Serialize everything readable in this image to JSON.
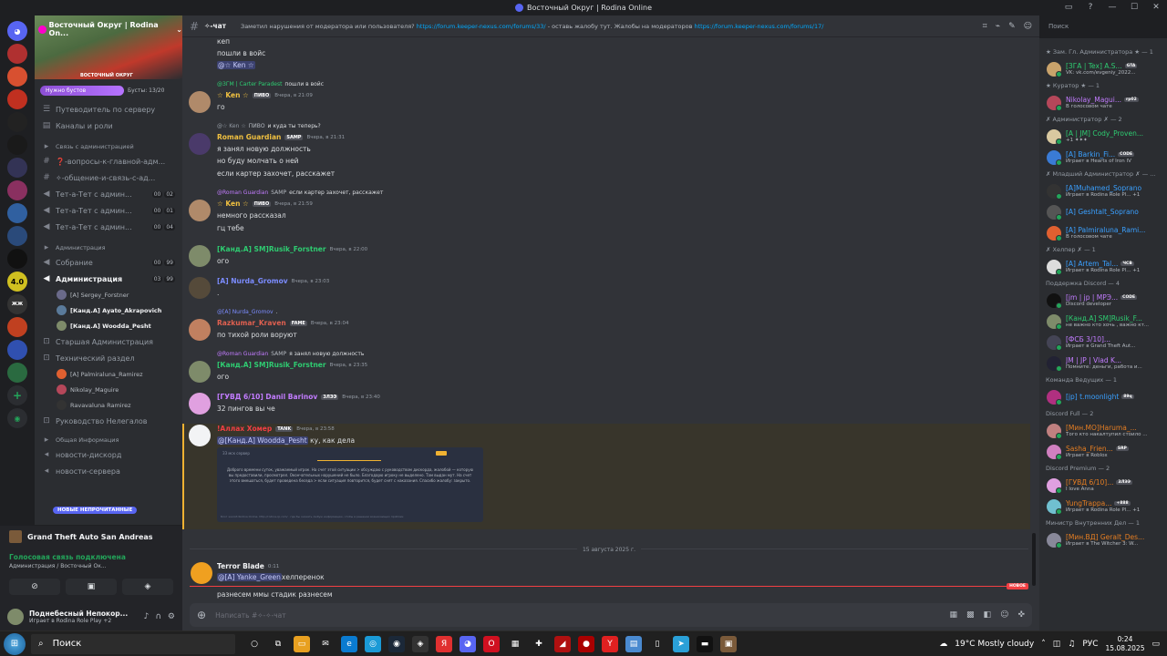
{
  "window": {
    "title": "Восточный Округ | Rodina Online",
    "controls": [
      "—",
      "☐",
      "✕"
    ]
  },
  "server": {
    "name": "Восточный Округ | Rodina On...",
    "banner_sub": "ВОСТОЧНЫЙ ОКРУГ",
    "boost_label": "Нужно бустов",
    "boost_count": "Бусты: 13/20"
  },
  "sidebar": {
    "guide": "Путеводитель по серверу",
    "channels_roles": "Каналы и роли",
    "items": [
      {
        "type": "cat",
        "label": "Связь с администрацией"
      },
      {
        "type": "text",
        "label": "❓-вопросы-к-главной-адм..."
      },
      {
        "type": "text",
        "label": "✧-общение-и-связь-с-ад..."
      },
      {
        "type": "voice",
        "label": "Тет-а-Тет с админ...",
        "b1": "00",
        "b2": "02"
      },
      {
        "type": "voice",
        "label": "Тет-а-Тет с админ...",
        "b1": "00",
        "b2": "01"
      },
      {
        "type": "voice",
        "label": "Тет-а-Тет с админ...",
        "b1": "00",
        "b2": "04"
      },
      {
        "type": "cat",
        "label": "Администрация"
      },
      {
        "type": "voice",
        "label": "Собрание",
        "b1": "00",
        "b2": "99"
      },
      {
        "type": "voice",
        "label": "Администрация",
        "b1": "03",
        "b2": "99",
        "active": true
      }
    ],
    "voice_users": [
      "[A] Sergey_Forstner",
      "[Канд.A] Ayato_Akrapovich",
      "[Канд.A] Woodda_Pesht"
    ],
    "items2": [
      {
        "type": "lock",
        "label": "Старшая Администрация"
      },
      {
        "type": "lock",
        "label": "Технический раздел"
      }
    ],
    "voice_users2": [
      "[A] Palmiraluna_Ramirez",
      "Nikolay_Maguire",
      "Ravavaluna Ramirez"
    ],
    "items3": [
      {
        "type": "lock",
        "label": "Руководство Нелегалов"
      },
      {
        "type": "cat",
        "label": "Общая Информация"
      },
      {
        "type": "ann",
        "label": "новости-дискорд"
      },
      {
        "type": "ann",
        "label": "новости-сервера"
      }
    ],
    "new_unread": "НОВЫЕ НЕПРОЧИТАННЫЕ"
  },
  "voice_panel": {
    "game": "Grand Theft Auto San Andreas",
    "status": "Голосовая связь подключена",
    "server_path": "Администрация / Восточный Ок...",
    "user_name": "Поднебесный Непокор...",
    "user_activity": "Играет в Rodina Role Play +2"
  },
  "chat": {
    "channel": "✧-чат",
    "topic_pre": "Заметил нарушения от модератора или пользователя?",
    "topic_link1": "https://forum.keeper-nexus.com/forums/33/",
    "topic_mid": "- оставь жалобу тут. Жалобы на модераторов",
    "topic_link2": "https://forum.keeper-nexus.com/forums/17/",
    "search": "Поиск",
    "messages": {
      "top1": "кеп",
      "top2": "пошли в войс",
      "top3": "@☆ Ken ☆",
      "m1_reply_name": "@ЗГМ | Carter Paradest",
      "m1_reply_text": "пошли в войс",
      "m1_name": "☆ Ken ☆",
      "m1_tag": "ПИВО",
      "m1_time": "Вчера, в 21:09",
      "m1_text": "го",
      "m2_reply_name": "@☆ Ken ☆",
      "m2_reply_tag": "ПИВО",
      "m2_reply_text": "и куда ты теперь?",
      "m2_name": "Roman Guardian",
      "m2_tag": "SAMP",
      "m2_time": "Вчера, в 21:31",
      "m2_l1": "я занял новую должность",
      "m2_l2": "но буду молчать о ней",
      "m2_l3": "если картер захочет, расскажет",
      "m3_reply_name": "@Roman Guardian",
      "m3_reply_tag": "SAMP",
      "m3_reply_text": "если картер захочет, расскажет",
      "m3_name": "☆ Ken ☆",
      "m3_tag": "ПИВО",
      "m3_time": "Вчера, в 21:59",
      "m3_l1": "немного рассказал",
      "m3_l2": "гц тебе",
      "m4_name": "[Канд.A] SM]Rusik_Forstner",
      "m4_time": "Вчера, в 22:00",
      "m4_text": "ого",
      "m5_name": "[A] Nurda_Gromov",
      "m5_time": "Вчера, в 23:03",
      "m5_text": ".",
      "m6_reply_name": "@[A] Nurda_Gromov",
      "m6_reply_text": ".",
      "m6_name": "Razkumar_Kraven",
      "m6_tag": "FAME",
      "m6_time": "Вчера, в 23:04",
      "m6_text": "по тихой роли воруют",
      "m7_reply_name": "@Roman Guardian",
      "m7_reply_tag": "SAMP",
      "m7_reply_text": "я занял новую должность",
      "m7_name": "[Канд.A] SM]Rusik_Forstner",
      "m7_time": "Вчера, в 23:35",
      "m7_text": "ого",
      "m8_name": "[ГУВД 6/10] Danil Barinov",
      "m8_tag": "ЗЛЭЭ",
      "m8_time": "Вчера, в 23:40",
      "m8_text": "32 пингов вы че",
      "m9_name": "!Аллах Хомер",
      "m9_tag": "TANK",
      "m9_time": "Вчера, в 23:58",
      "m9_mention": "@[Канд.A] Woodda_Pesht",
      "m9_text": "ку, как дела",
      "embed_title": "ЗЗ мск сервер",
      "embed_text": "Доброго времени суток, уважаемый игрок. На счет этой ситуации > обсуждаю с руководством дискорда, жалобой — которую вы предоставили, просмотрел. Окончательных нарушений не было. Благодарю игроку не выделено. Там выдан мут. На счет этого вмешаться, будет проведена беседа > если ситуация повторится, будет снят с наказания. Спасибо жалобу: закрыто.",
      "embed_footer": "Блог жалоб Rodina Online. http://rodina-rp.com/ · где бы оказать любую информацию, чтобы в решении возникающих проблем",
      "date_divider": "15 августа 2025 г.",
      "m10_name": "Terror Blade",
      "m10_time": "0:11",
      "m10_mention": "@[A] Yanke_Green",
      "m10_text": "хелперенок",
      "new_label": "НОВОЕ",
      "m11_text": "разнесем ммы стадик разнесем"
    },
    "input_placeholder": "Написать #✧-✧-чат"
  },
  "members": [
    {
      "group": "★ Зам. Гл. Администратора ★ — 1"
    },
    {
      "name": "[ЗГА | Tex] A.S...",
      "tag": "GTA",
      "status": "VK: vk.com/evgeniy_2022...",
      "color": "#2ecc71",
      "av": "#c9a36b"
    },
    {
      "group": "★ Куратор ★ — 1"
    },
    {
      "name": "Nikolay_Magui...",
      "tag": "rp02",
      "status": "В голосовом чате",
      "color": "#c27cff",
      "av": "#b5475a"
    },
    {
      "group": "✗ Администратор ✗ — 2"
    },
    {
      "name": "[A | JM] Cody_Proven...",
      "tag": "",
      "status": "+1 ✦✦✦",
      "color": "#2ecc71",
      "av": "#d9c9a0"
    },
    {
      "name": "[A] Barkin_Fi...",
      "tag": "CODE",
      "status": "Играет в Hearts of Iron IV",
      "color": "#3aa0ff",
      "av": "#3a7bd5"
    },
    {
      "group": "✗ Младший Администратор ✗ — ..."
    },
    {
      "name": "[A]Muhamed_Soprano",
      "tag": "",
      "status": "Играет в Rodina Role Pl... +1",
      "color": "#3aa0ff",
      "av": "#333"
    },
    {
      "name": "[A] Geshtalt_Soprano",
      "tag": "",
      "status": "",
      "color": "#3aa0ff",
      "av": "#555"
    },
    {
      "name": "[A] Palmiraluna_Rami...",
      "tag": "",
      "status": "В голосовом чате",
      "color": "#3aa0ff",
      "av": "#e06030"
    },
    {
      "group": "✗ Хелпер ✗ — 1"
    },
    {
      "name": "[A] Artem_Tal...",
      "tag": "ЧСВ",
      "status": "Играет в Rodina Role Pl... +1",
      "color": "#3aa0ff",
      "av": "#ddd"
    },
    {
      "group": "Поддержка Discord — 4"
    },
    {
      "name": "[jm | jp | МРЭ...",
      "tag": "CODE",
      "status": "Discord developer",
      "color": "#c27cff",
      "av": "#111"
    },
    {
      "name": "[Канд.A] SM]Rusik_F...",
      "tag": "",
      "status": "не важно кто хочь , важно кт...",
      "color": "#2ecc71",
      "av": "#7e8b6a"
    },
    {
      "name": "[ФСБ 3/10]...",
      "tag": "",
      "status": "Играет в Grand Theft Aut...",
      "color": "#c27cff",
      "av": "#445"
    },
    {
      "name": "JM | JP | Vlad K...",
      "tag": "",
      "status": "Помните: деньги, работа и...",
      "color": "#c27cff",
      "av": "#223"
    },
    {
      "group": "Команда Ведущих — 1"
    },
    {
      "name": "[jp] t.moonlight",
      "tag": "89q",
      "status": "",
      "color": "#3aa0ff",
      "av": "#b03080"
    },
    {
      "group": "Discord Full — 2"
    },
    {
      "name": "[Мин.МО]Haruma_...",
      "tag": "",
      "status": "Того кто накалтупил стоило ...",
      "color": "#e67e22",
      "av": "#c08080"
    },
    {
      "name": "Sasha_Frien...",
      "tag": "SRP",
      "status": "Играет в Roblox",
      "color": "#e67e22",
      "av": "#d080c0"
    },
    {
      "group": "Discord Premium — 2"
    },
    {
      "name": "[ГУВД 6/10]...",
      "tag": "ЗЛЭЭ",
      "status": "I love Anna",
      "color": "#e67e22",
      "av": "#e0a0e0"
    },
    {
      "name": "YungTrappa...",
      "tag": "+888",
      "status": "Играет в Rodina Role Pl... +1",
      "color": "#e67e22",
      "av": "#70c0d0"
    },
    {
      "group": "Министр Внутренних Дел — 1"
    },
    {
      "name": "[Мин.ВД] Geralt_Des...",
      "tag": "",
      "status": "Играет в The Witcher 3: W...",
      "color": "#e67e22",
      "av": "#889"
    }
  ],
  "taskbar": {
    "search": "Поиск",
    "weather": "19°C  Mostly cloudy",
    "lang": "РУС",
    "time": "0:24",
    "date": "15.08.2025"
  },
  "colors": {
    "bg": "#313338",
    "sidebar": "#2b2d31",
    "blurple": "#5865f2",
    "green": "#23a55a",
    "red": "#f23f43"
  }
}
